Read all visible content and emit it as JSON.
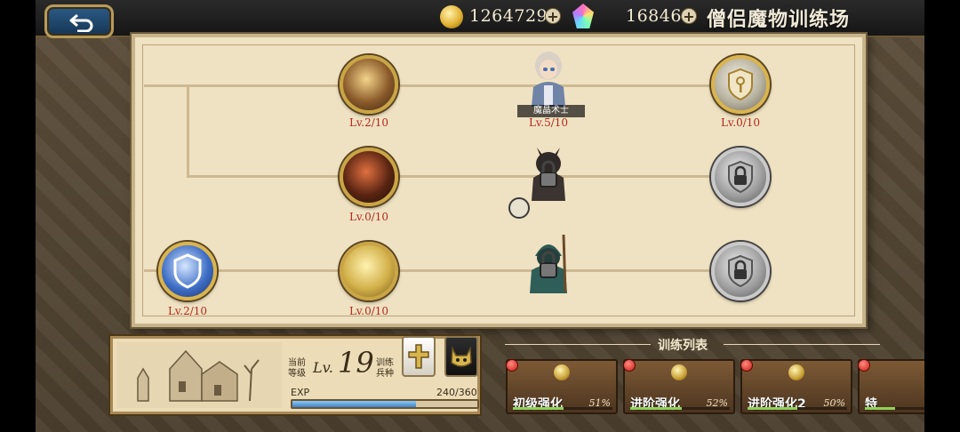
{
  "header": {
    "title": "僧侣魔物训练场",
    "gold": "1264729",
    "gems": "16846",
    "plus_label": "+"
  },
  "tree": {
    "nodes": [
      {
        "level": "Lv.2/10"
      },
      {
        "level": "Lv.5/10",
        "name": "魔晶术士"
      },
      {
        "level": "Lv.0/10"
      },
      {
        "level": "Lv.0/10"
      },
      {
        "level": "Lv.2/10"
      },
      {
        "level": "Lv.0/10"
      }
    ]
  },
  "level_panel": {
    "current_label_1": "当前",
    "current_label_2": "等级",
    "level_prefix": "Lv.",
    "level_value": "19",
    "train_label_1": "训练",
    "train_label_2": "兵种",
    "exp_label": "EXP",
    "exp_value": "240/360",
    "exp_fraction": 0.667
  },
  "training_list": {
    "title": "训练列表",
    "items": [
      {
        "label": "初级强化",
        "percent": "51%",
        "fraction": 0.51
      },
      {
        "label": "进阶强化",
        "percent": "52%",
        "fraction": 0.52
      },
      {
        "label": "进阶强化2",
        "percent": "50%",
        "fraction": 0.5
      },
      {
        "label": "特",
        "percent": "",
        "fraction": 0.5
      }
    ]
  },
  "colors": {
    "level_text": "#b3281e",
    "gold_border": "#c9a545",
    "exp_fill": "#3f85c8"
  }
}
